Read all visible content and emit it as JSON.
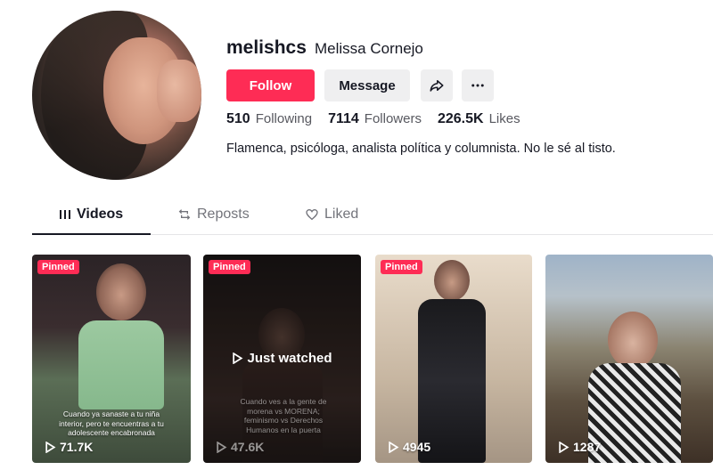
{
  "profile": {
    "username": "melishcs",
    "nickname": "Melissa  Cornejo",
    "bio": "Flamenca, psicóloga, analista política y columnista. No le sé al tisto."
  },
  "actions": {
    "follow_label": "Follow",
    "message_label": "Message",
    "share_icon": "share-icon",
    "more_icon": "more-icon"
  },
  "stats": {
    "following_count": "510",
    "following_label": "Following",
    "followers_count": "7114",
    "followers_label": "Followers",
    "likes_count": "226.5K",
    "likes_label": "Likes"
  },
  "tabs": [
    {
      "label": "Videos",
      "icon": "grid-icon",
      "active": true
    },
    {
      "label": "Reposts",
      "icon": "repost-icon",
      "active": false
    },
    {
      "label": "Liked",
      "icon": "heart-icon",
      "active": false
    }
  ],
  "videos": [
    {
      "pinned_label": "Pinned",
      "views": "71.7K",
      "caption": "Cuando ya sanaste a tu niña interior, pero te encuentras a tu adolescente encabronada"
    },
    {
      "pinned_label": "Pinned",
      "views": "47.6K",
      "overlay_label": "Just watched",
      "caption": "Cuando ves a la gente de morena vs MORENA; feminismo vs Derechos Humanos en la puerta"
    },
    {
      "pinned_label": "Pinned",
      "views": "4945"
    },
    {
      "views": "1287"
    }
  ],
  "colors": {
    "accent": "#fe2c55",
    "text_primary": "#161823",
    "text_secondary": "#57585f",
    "button_gray": "#efeff0"
  }
}
